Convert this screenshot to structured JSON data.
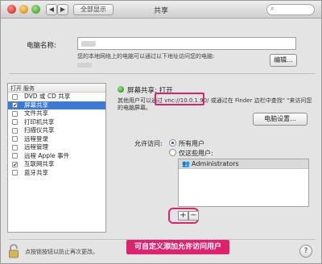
{
  "window": {
    "title": "共享"
  },
  "toolbar": {
    "back": "◀",
    "forward": "▶",
    "show_all": "全部显示",
    "search_icon": "search-icon"
  },
  "computer_name": {
    "label": "电脑名称:",
    "description": "您的本地网络上的电脑可以通过以下地址访问您的电脑:",
    "edit_button": "编辑..."
  },
  "service_list": {
    "header_on": "打开",
    "header_service": "服务",
    "items": [
      {
        "label": "DVD 或 CD 共享",
        "checked": false,
        "selected": false
      },
      {
        "label": "屏幕共享",
        "checked": true,
        "selected": true
      },
      {
        "label": "文件共享",
        "checked": false,
        "selected": false
      },
      {
        "label": "打印机共享",
        "checked": false,
        "selected": false
      },
      {
        "label": "扫描仪共享",
        "checked": false,
        "selected": false
      },
      {
        "label": "远程登录",
        "checked": false,
        "selected": false
      },
      {
        "label": "远程管理",
        "checked": false,
        "selected": false
      },
      {
        "label": "远程 Apple 事件",
        "checked": false,
        "selected": false
      },
      {
        "label": "互联网共享",
        "checked": true,
        "selected": false
      },
      {
        "label": "蓝牙共享",
        "checked": false,
        "selected": false
      }
    ]
  },
  "screen_sharing": {
    "status": "屏幕共享: 打开",
    "desc_prefix": "其他用户可以通过",
    "vnc_address": "vnc://10.0.1.90/",
    "desc_suffix": "或通过在 Finder 边栏中查找\"      \"来访问您",
    "desc_line2": "的电脑屏幕。",
    "computer_settings_button": "电脑设置..."
  },
  "access": {
    "label": "允许访问:",
    "option_all": "所有用户",
    "option_only": "仅这些用户:",
    "selected_option": "all",
    "users": [
      {
        "name": "Administrators",
        "icon": "group-icon"
      }
    ],
    "add_button": "+",
    "remove_button": "−"
  },
  "footer": {
    "lock_text": "点按锁按钮以防止再次更改。",
    "help_button": "?"
  },
  "annotation": {
    "text": "可自定义添加允许访问用户",
    "color": "#e0226e"
  }
}
